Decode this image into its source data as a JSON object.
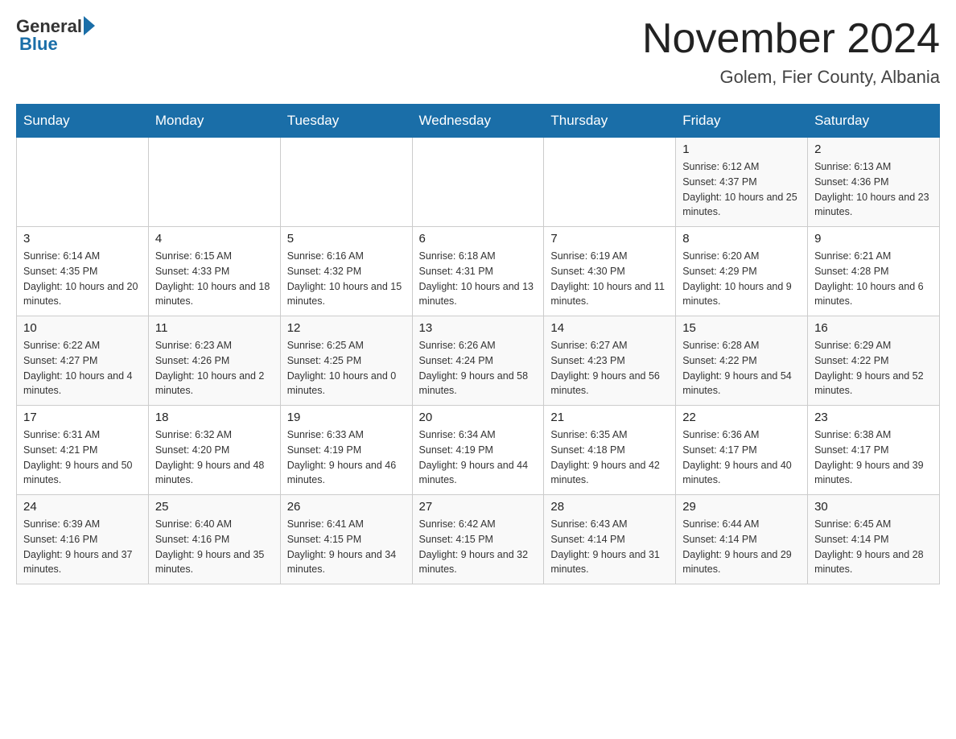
{
  "header": {
    "logo_general": "General",
    "logo_blue": "Blue",
    "month_year": "November 2024",
    "location": "Golem, Fier County, Albania"
  },
  "days_of_week": [
    "Sunday",
    "Monday",
    "Tuesday",
    "Wednesday",
    "Thursday",
    "Friday",
    "Saturday"
  ],
  "weeks": [
    [
      {
        "day": "",
        "sunrise": "",
        "sunset": "",
        "daylight": ""
      },
      {
        "day": "",
        "sunrise": "",
        "sunset": "",
        "daylight": ""
      },
      {
        "day": "",
        "sunrise": "",
        "sunset": "",
        "daylight": ""
      },
      {
        "day": "",
        "sunrise": "",
        "sunset": "",
        "daylight": ""
      },
      {
        "day": "",
        "sunrise": "",
        "sunset": "",
        "daylight": ""
      },
      {
        "day": "1",
        "sunrise": "Sunrise: 6:12 AM",
        "sunset": "Sunset: 4:37 PM",
        "daylight": "Daylight: 10 hours and 25 minutes."
      },
      {
        "day": "2",
        "sunrise": "Sunrise: 6:13 AM",
        "sunset": "Sunset: 4:36 PM",
        "daylight": "Daylight: 10 hours and 23 minutes."
      }
    ],
    [
      {
        "day": "3",
        "sunrise": "Sunrise: 6:14 AM",
        "sunset": "Sunset: 4:35 PM",
        "daylight": "Daylight: 10 hours and 20 minutes."
      },
      {
        "day": "4",
        "sunrise": "Sunrise: 6:15 AM",
        "sunset": "Sunset: 4:33 PM",
        "daylight": "Daylight: 10 hours and 18 minutes."
      },
      {
        "day": "5",
        "sunrise": "Sunrise: 6:16 AM",
        "sunset": "Sunset: 4:32 PM",
        "daylight": "Daylight: 10 hours and 15 minutes."
      },
      {
        "day": "6",
        "sunrise": "Sunrise: 6:18 AM",
        "sunset": "Sunset: 4:31 PM",
        "daylight": "Daylight: 10 hours and 13 minutes."
      },
      {
        "day": "7",
        "sunrise": "Sunrise: 6:19 AM",
        "sunset": "Sunset: 4:30 PM",
        "daylight": "Daylight: 10 hours and 11 minutes."
      },
      {
        "day": "8",
        "sunrise": "Sunrise: 6:20 AM",
        "sunset": "Sunset: 4:29 PM",
        "daylight": "Daylight: 10 hours and 9 minutes."
      },
      {
        "day": "9",
        "sunrise": "Sunrise: 6:21 AM",
        "sunset": "Sunset: 4:28 PM",
        "daylight": "Daylight: 10 hours and 6 minutes."
      }
    ],
    [
      {
        "day": "10",
        "sunrise": "Sunrise: 6:22 AM",
        "sunset": "Sunset: 4:27 PM",
        "daylight": "Daylight: 10 hours and 4 minutes."
      },
      {
        "day": "11",
        "sunrise": "Sunrise: 6:23 AM",
        "sunset": "Sunset: 4:26 PM",
        "daylight": "Daylight: 10 hours and 2 minutes."
      },
      {
        "day": "12",
        "sunrise": "Sunrise: 6:25 AM",
        "sunset": "Sunset: 4:25 PM",
        "daylight": "Daylight: 10 hours and 0 minutes."
      },
      {
        "day": "13",
        "sunrise": "Sunrise: 6:26 AM",
        "sunset": "Sunset: 4:24 PM",
        "daylight": "Daylight: 9 hours and 58 minutes."
      },
      {
        "day": "14",
        "sunrise": "Sunrise: 6:27 AM",
        "sunset": "Sunset: 4:23 PM",
        "daylight": "Daylight: 9 hours and 56 minutes."
      },
      {
        "day": "15",
        "sunrise": "Sunrise: 6:28 AM",
        "sunset": "Sunset: 4:22 PM",
        "daylight": "Daylight: 9 hours and 54 minutes."
      },
      {
        "day": "16",
        "sunrise": "Sunrise: 6:29 AM",
        "sunset": "Sunset: 4:22 PM",
        "daylight": "Daylight: 9 hours and 52 minutes."
      }
    ],
    [
      {
        "day": "17",
        "sunrise": "Sunrise: 6:31 AM",
        "sunset": "Sunset: 4:21 PM",
        "daylight": "Daylight: 9 hours and 50 minutes."
      },
      {
        "day": "18",
        "sunrise": "Sunrise: 6:32 AM",
        "sunset": "Sunset: 4:20 PM",
        "daylight": "Daylight: 9 hours and 48 minutes."
      },
      {
        "day": "19",
        "sunrise": "Sunrise: 6:33 AM",
        "sunset": "Sunset: 4:19 PM",
        "daylight": "Daylight: 9 hours and 46 minutes."
      },
      {
        "day": "20",
        "sunrise": "Sunrise: 6:34 AM",
        "sunset": "Sunset: 4:19 PM",
        "daylight": "Daylight: 9 hours and 44 minutes."
      },
      {
        "day": "21",
        "sunrise": "Sunrise: 6:35 AM",
        "sunset": "Sunset: 4:18 PM",
        "daylight": "Daylight: 9 hours and 42 minutes."
      },
      {
        "day": "22",
        "sunrise": "Sunrise: 6:36 AM",
        "sunset": "Sunset: 4:17 PM",
        "daylight": "Daylight: 9 hours and 40 minutes."
      },
      {
        "day": "23",
        "sunrise": "Sunrise: 6:38 AM",
        "sunset": "Sunset: 4:17 PM",
        "daylight": "Daylight: 9 hours and 39 minutes."
      }
    ],
    [
      {
        "day": "24",
        "sunrise": "Sunrise: 6:39 AM",
        "sunset": "Sunset: 4:16 PM",
        "daylight": "Daylight: 9 hours and 37 minutes."
      },
      {
        "day": "25",
        "sunrise": "Sunrise: 6:40 AM",
        "sunset": "Sunset: 4:16 PM",
        "daylight": "Daylight: 9 hours and 35 minutes."
      },
      {
        "day": "26",
        "sunrise": "Sunrise: 6:41 AM",
        "sunset": "Sunset: 4:15 PM",
        "daylight": "Daylight: 9 hours and 34 minutes."
      },
      {
        "day": "27",
        "sunrise": "Sunrise: 6:42 AM",
        "sunset": "Sunset: 4:15 PM",
        "daylight": "Daylight: 9 hours and 32 minutes."
      },
      {
        "day": "28",
        "sunrise": "Sunrise: 6:43 AM",
        "sunset": "Sunset: 4:14 PM",
        "daylight": "Daylight: 9 hours and 31 minutes."
      },
      {
        "day": "29",
        "sunrise": "Sunrise: 6:44 AM",
        "sunset": "Sunset: 4:14 PM",
        "daylight": "Daylight: 9 hours and 29 minutes."
      },
      {
        "day": "30",
        "sunrise": "Sunrise: 6:45 AM",
        "sunset": "Sunset: 4:14 PM",
        "daylight": "Daylight: 9 hours and 28 minutes."
      }
    ]
  ]
}
